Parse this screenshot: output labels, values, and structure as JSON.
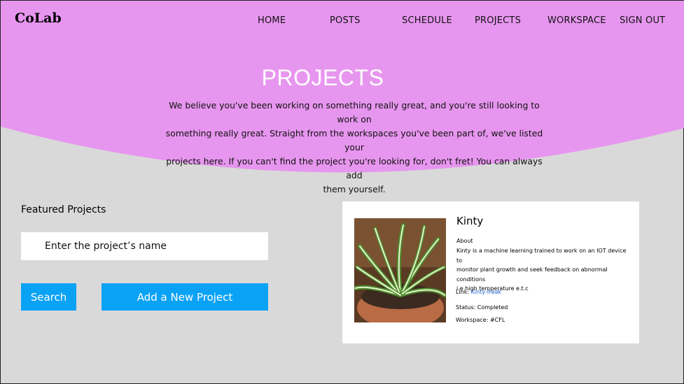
{
  "header": {
    "logo": "CoLab",
    "nav": [
      "HOME",
      "POSTS",
      "SCHEDULE",
      "PROJECTS",
      "WORKSPACE",
      "SIGN OUT"
    ]
  },
  "hero": {
    "title": "PROJECTS",
    "lines": [
      "We believe you've been working on something really great, and you're still looking to work on",
      "something really great. Straight from the workspaces you've been part of, we've listed your",
      "projects here. If you can't find the project you're looking for, don't fret! You can always add",
      "them yourself."
    ]
  },
  "featured": {
    "label": "Featured Projects",
    "search_placeholder": "Enter the project’s name",
    "search_button": "Search",
    "add_button": "Add a New Project"
  },
  "project_card": {
    "name": "Kinty",
    "about_label": "About",
    "about_lines": [
      "Kinty is a machine learning trained to work on an IOT device to",
      "monitor plant growth and seek feedback on abnormal conditions",
      "i.e high temperature e.t.c"
    ],
    "link_label": "Link:",
    "link_text": "Kinty-freak",
    "status_label": "Status:",
    "status_value": "Completed",
    "workspace_label": "Workspace:",
    "workspace_value": "#CFL",
    "image_icon": "plant-photo"
  },
  "colors": {
    "hero": "#e796ef",
    "background": "#d9d9d9",
    "accent": "#0aa2f5",
    "link": "#1a5fd0"
  }
}
